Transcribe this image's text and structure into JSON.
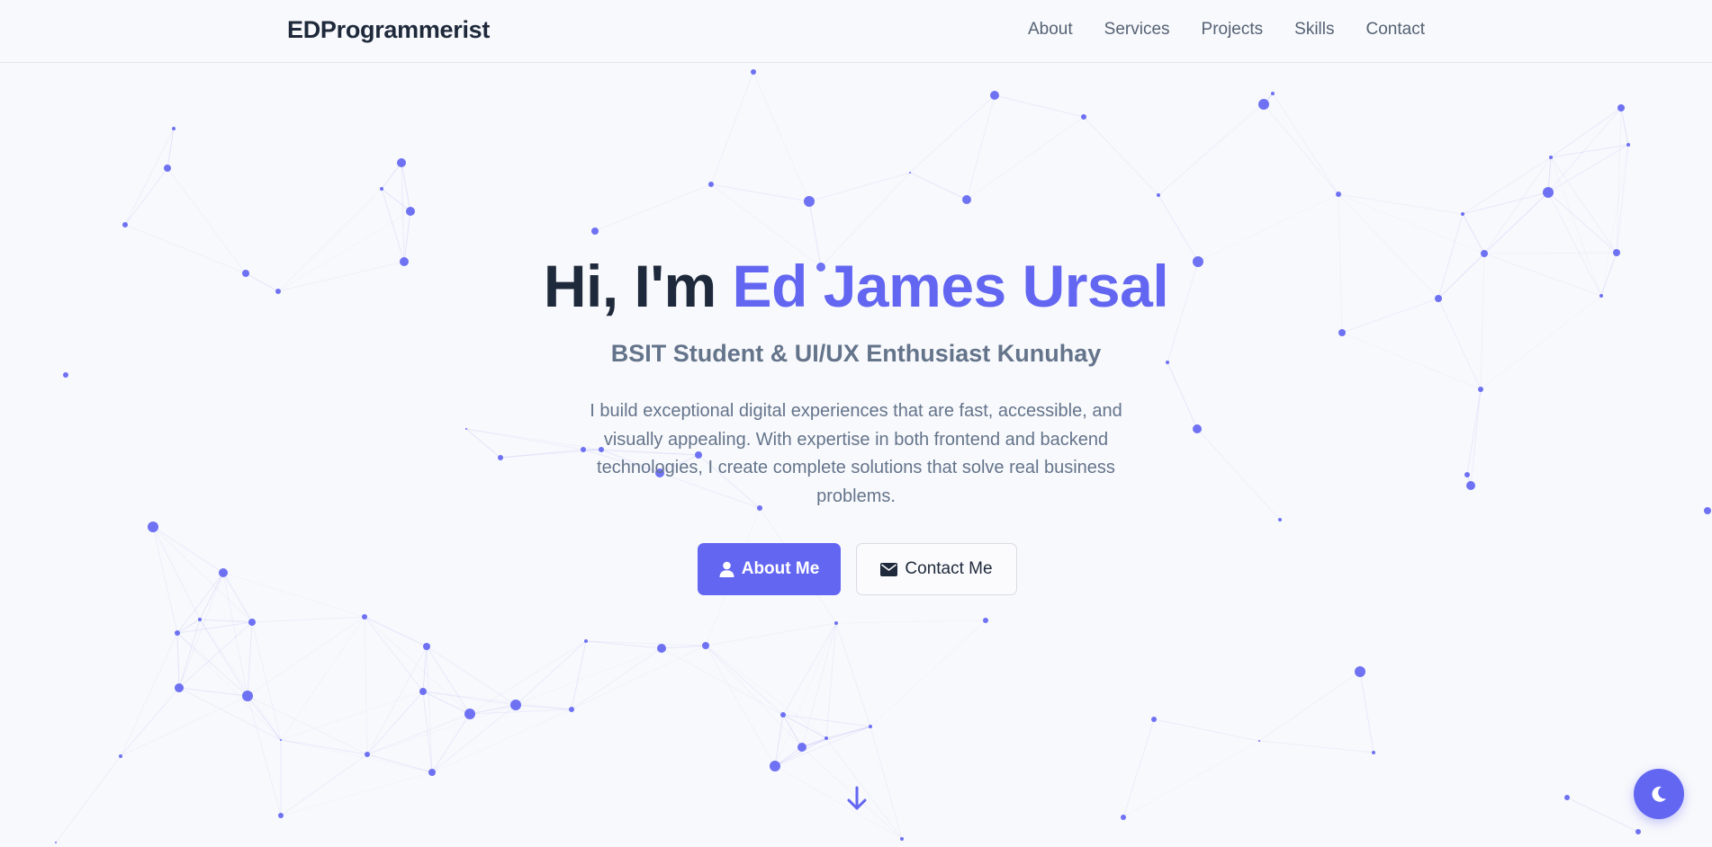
{
  "navbar": {
    "brand": "EDProgrammerist",
    "links": [
      "About",
      "Services",
      "Projects",
      "Skills",
      "Contact"
    ]
  },
  "hero": {
    "greeting": "Hi, I'm ",
    "name": "Ed James Ursal",
    "subtitle": "BSIT Student & UI/UX Enthusiast Kunuhay",
    "description": "I build exceptional digital experiences that are fast, accessible, and visually appealing. With expertise in both frontend and backend technologies, I create complete solutions that solve real business problems.",
    "buttons": {
      "primary": {
        "label": "About Me",
        "icon": "user-icon"
      },
      "secondary": {
        "label": "Contact Me",
        "icon": "envelope-icon"
      }
    },
    "scroll_icon": "arrow-down-icon"
  },
  "theme_toggle": {
    "icon": "moon-icon"
  },
  "colors": {
    "accent": "#6366f1",
    "heading": "#1e293b",
    "muted": "#64748b",
    "background": "#f8f9fc"
  },
  "background_decoration": "particle-network"
}
